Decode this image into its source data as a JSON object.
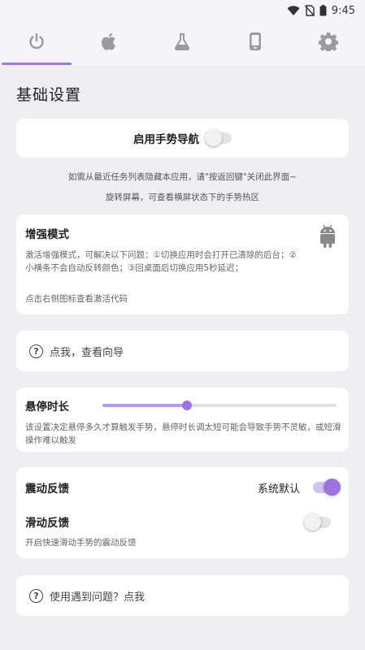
{
  "status_bar": {
    "time": "9:45"
  },
  "tabs": [
    {
      "icon": "power-icon",
      "active": true
    },
    {
      "icon": "apple-icon",
      "active": false
    },
    {
      "icon": "flask-icon",
      "active": false
    },
    {
      "icon": "phone-icon",
      "active": false
    },
    {
      "icon": "gear-icon",
      "active": false
    }
  ],
  "page_title": "基础设置",
  "gesture_nav": {
    "label": "启用手势导航",
    "enabled": false
  },
  "hints": {
    "line1": "如需从最近任务列表隐藏本应用，请\"按返回键\"关闭此界面~",
    "line2": "旋转屏幕，可查看横屏状态下的手势热区"
  },
  "enhanced_mode": {
    "title": "增强模式",
    "description": "激活增强模式，可解决以下问题：①切换应用时会打开已清除的后台；②小横条不会自动反转颜色；③回桌面后切换应用5秒延迟；",
    "footer": "点击右侧图标查看激活代码",
    "icon": "android-icon"
  },
  "guide": {
    "label": "点我，查看向导",
    "icon": "question-icon"
  },
  "hover_duration": {
    "title": "悬停时长",
    "value_fraction": 0.36,
    "description": "该设置决定悬停多久才算触发手势，悬停时长调太短可能会导致手势不灵敏，或短滑操作难以触发"
  },
  "feedback": {
    "vibration_title": "震动反馈",
    "vibration_value": "系统默认",
    "vibration_enabled": true,
    "slide_title": "滑动反馈",
    "slide_enabled": false,
    "slide_description": "开启快速滑动手势的震动反馈"
  },
  "problem": {
    "label": "使用遇到问题？点我",
    "icon": "question-icon"
  },
  "colors": {
    "accent": "#9d73e0",
    "accent_light": "#d4c2f2",
    "background": "#efeff1"
  }
}
